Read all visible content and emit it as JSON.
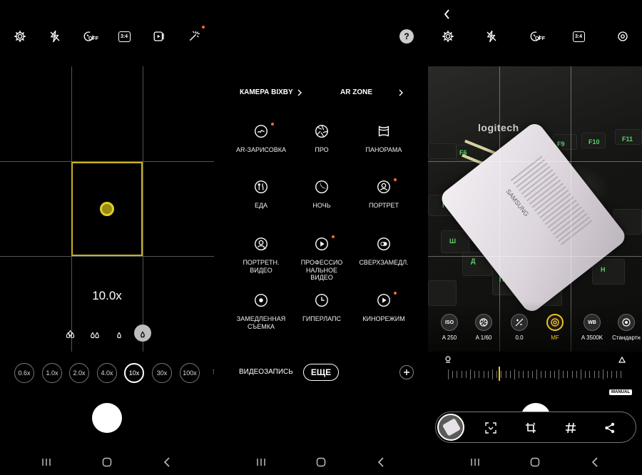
{
  "panel1": {
    "zoom_label": "10.0x",
    "zoom_options": [
      "0.6x",
      "1.0x",
      "2.0x",
      "4.0x",
      "10x",
      "30x",
      "100x"
    ],
    "active_zoom_index": 4,
    "partial_mode_label": "ЯЯ"
  },
  "panel2": {
    "bixby_label": "КАМЕРА BIXBY",
    "arzone_label": "AR ZONE",
    "modes": [
      {
        "label": "AR-ЗАРИСОВКА",
        "icon": "ar-doodle-icon",
        "dot": true
      },
      {
        "label": "ПРО",
        "icon": "aperture-icon",
        "dot": false
      },
      {
        "label": "ПАНОРАМА",
        "icon": "panorama-icon",
        "dot": false
      },
      {
        "label": "ЕДА",
        "icon": "food-icon",
        "dot": false
      },
      {
        "label": "НОЧЬ",
        "icon": "moon-icon",
        "dot": false
      },
      {
        "label": "ПОРТРЕТ",
        "icon": "portrait-icon",
        "dot": true
      },
      {
        "label": "ПОРТРЕТН.\nВИДЕО",
        "icon": "portrait-video-icon",
        "dot": false
      },
      {
        "label": "ПРОФЕССИО\nНАЛЬНОЕ\nВИДЕО",
        "icon": "pro-video-icon",
        "dot": true
      },
      {
        "label": "СВЕРХЗАМЕДЛ.",
        "icon": "super-slow-icon",
        "dot": false
      },
      {
        "label": "ЗАМЕДЛЕННАЯ\nСЪЕМКА",
        "icon": "slow-motion-icon",
        "dot": false
      },
      {
        "label": "ГИПЕРЛАПС",
        "icon": "hyperlapse-icon",
        "dot": false
      },
      {
        "label": "КИНОРЕЖИМ",
        "icon": "cinema-icon",
        "dot": true
      }
    ],
    "video_label": "ВИДЕОЗАПИСЬ",
    "more_label": "ЕЩЕ"
  },
  "panel3": {
    "photo_text": {
      "brand": "logitech",
      "keys": [
        "F6",
        "F9",
        "F10",
        "F11"
      ],
      "key_letters": [
        "Г",
        "Ш",
        "Д",
        "П",
        "С",
        "Н"
      ],
      "charger_brand": "SAMSUNG"
    },
    "settings": [
      {
        "id": "iso",
        "icon_text": "ISO",
        "value": "A 250",
        "active": false
      },
      {
        "id": "shutter",
        "icon_text": "",
        "value": "A 1/60",
        "active": false
      },
      {
        "id": "ev",
        "icon_text": "",
        "value": "0.0",
        "active": false
      },
      {
        "id": "focus",
        "icon_text": "",
        "value": "MF",
        "active": true
      },
      {
        "id": "wb",
        "icon_text": "WB",
        "value": "A 3500K",
        "active": false
      },
      {
        "id": "tone",
        "icon_text": "",
        "value": "Стандартн",
        "active": false
      }
    ],
    "manual_badge": "MANUAL",
    "timer_off": "OFF",
    "ratio": "3:4"
  },
  "panel1_timer_off": "OFF",
  "panel1_ratio": "3:4",
  "colors": {
    "accent_yellow": "#e0cf2a",
    "focus_frame": "#c9b21e",
    "mf_active": "#f3c21d",
    "notify_dot": "#ff6a2b",
    "key_green": "#5fd26a"
  }
}
